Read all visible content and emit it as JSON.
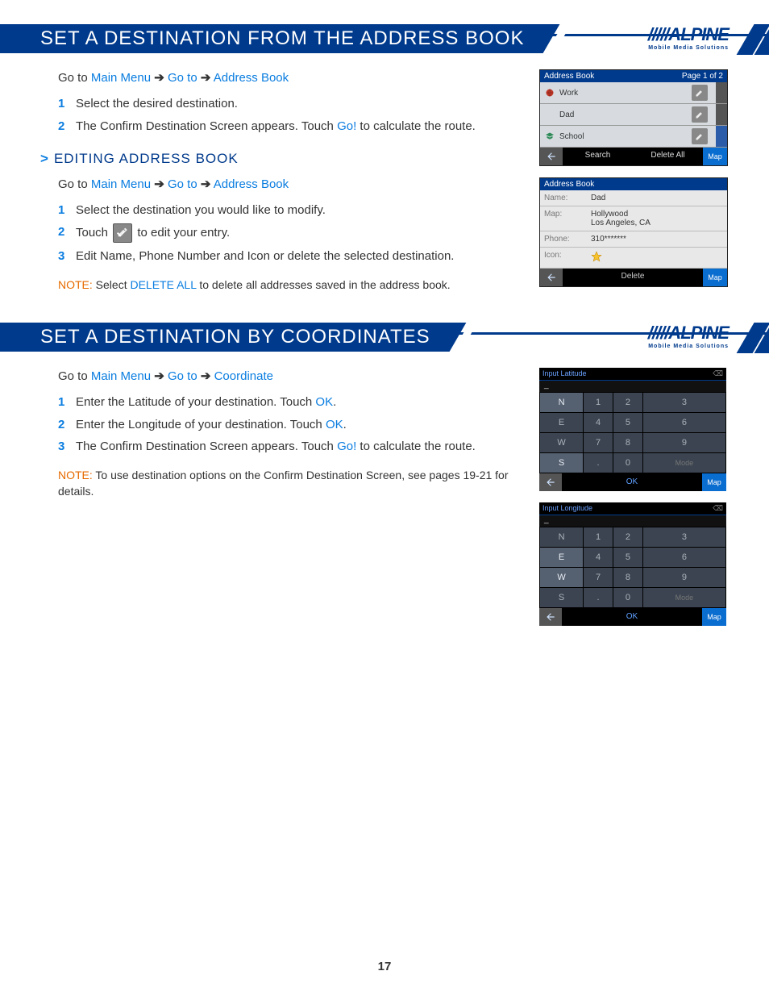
{
  "section1": {
    "title": "SET A DESTINATION FROM THE ADDRESS BOOK",
    "nav_prefix": "Go to ",
    "nav1": "Main Menu",
    "nav2": "Go to",
    "nav3": "Address Book",
    "arrow": "➔",
    "step1": "Select the desired destination.",
    "step2a": "The Confirm Destination Screen appears. Touch ",
    "step2_go": "Go!",
    "step2b": " to calculate the route.",
    "sub_title": "EDITING ADDRESS BOOK",
    "sub_nav_prefix": "Go to ",
    "sub_nav1": "Main Menu",
    "sub_nav2": "Go to",
    "sub_nav3": "Address Book",
    "sub_step1": "Select the destination you would like to modify.",
    "sub_step2a": "Touch ",
    "sub_step2b": " to edit your entry.",
    "sub_step3": "Edit Name, Phone Number and Icon or delete the selected destination.",
    "note_lbl": "NOTE:",
    "note_a": " Select ",
    "note_del": "DELETE ALL",
    "note_b": " to delete all addresses saved in the address book."
  },
  "shot_ab": {
    "header": "Address Book",
    "page": "Page 1 of 2",
    "items": [
      "Work",
      "Dad",
      "School"
    ],
    "search": "Search",
    "delete_all": "Delete All",
    "map": "Map"
  },
  "shot_detail": {
    "header": "Address Book",
    "name_lbl": "Name:",
    "name_val": "Dad",
    "map_lbl": "Map:",
    "map_val": "Hollywood\nLos Angeles, CA",
    "phone_lbl": "Phone:",
    "phone_val": "310*******",
    "icon_lbl": "Icon:",
    "delete": "Delete",
    "map_btn": "Map"
  },
  "section2": {
    "title": "SET A DESTINATION BY COORDINATES",
    "nav_prefix": "Go to ",
    "nav1": "Main Menu",
    "nav2": "Go to",
    "nav3": "Coordinate",
    "arrow": "➔",
    "step1a": "Enter the Latitude of your destination. Touch ",
    "step1_ok": "OK",
    "step1b": ".",
    "step2a": "Enter the Longitude of your destination. Touch ",
    "step2_ok": "OK",
    "step2b": ".",
    "step3a": "The Confirm Destination Screen appears. Touch ",
    "step3_go": "Go!",
    "step3b": " to calculate the route.",
    "note_lbl": "NOTE:",
    "note_txt": " To use destination options on the Confirm Destination Screen, see pages 19-21 for details."
  },
  "shot_lat": {
    "header": "Input Latitude",
    "disp": "_",
    "rows": [
      [
        "N",
        "1",
        "2",
        "3"
      ],
      [
        "E",
        "4",
        "5",
        "6"
      ],
      [
        "W",
        "7",
        "8",
        "9"
      ],
      [
        "S",
        ".",
        "0",
        "Mode"
      ]
    ],
    "active": [
      "N",
      "S"
    ],
    "ok": "OK",
    "map": "Map"
  },
  "shot_lon": {
    "header": "Input Longitude",
    "disp": "_",
    "rows": [
      [
        "N",
        "1",
        "2",
        "3"
      ],
      [
        "E",
        "4",
        "5",
        "6"
      ],
      [
        "W",
        "7",
        "8",
        "9"
      ],
      [
        "S",
        ".",
        "0",
        "Mode"
      ]
    ],
    "active": [
      "E",
      "W"
    ],
    "ok": "OK",
    "map": "Map"
  },
  "logo": {
    "brand": "/////ALPINE",
    "sub": "Mobile Media Solutions"
  },
  "page_number": "17"
}
